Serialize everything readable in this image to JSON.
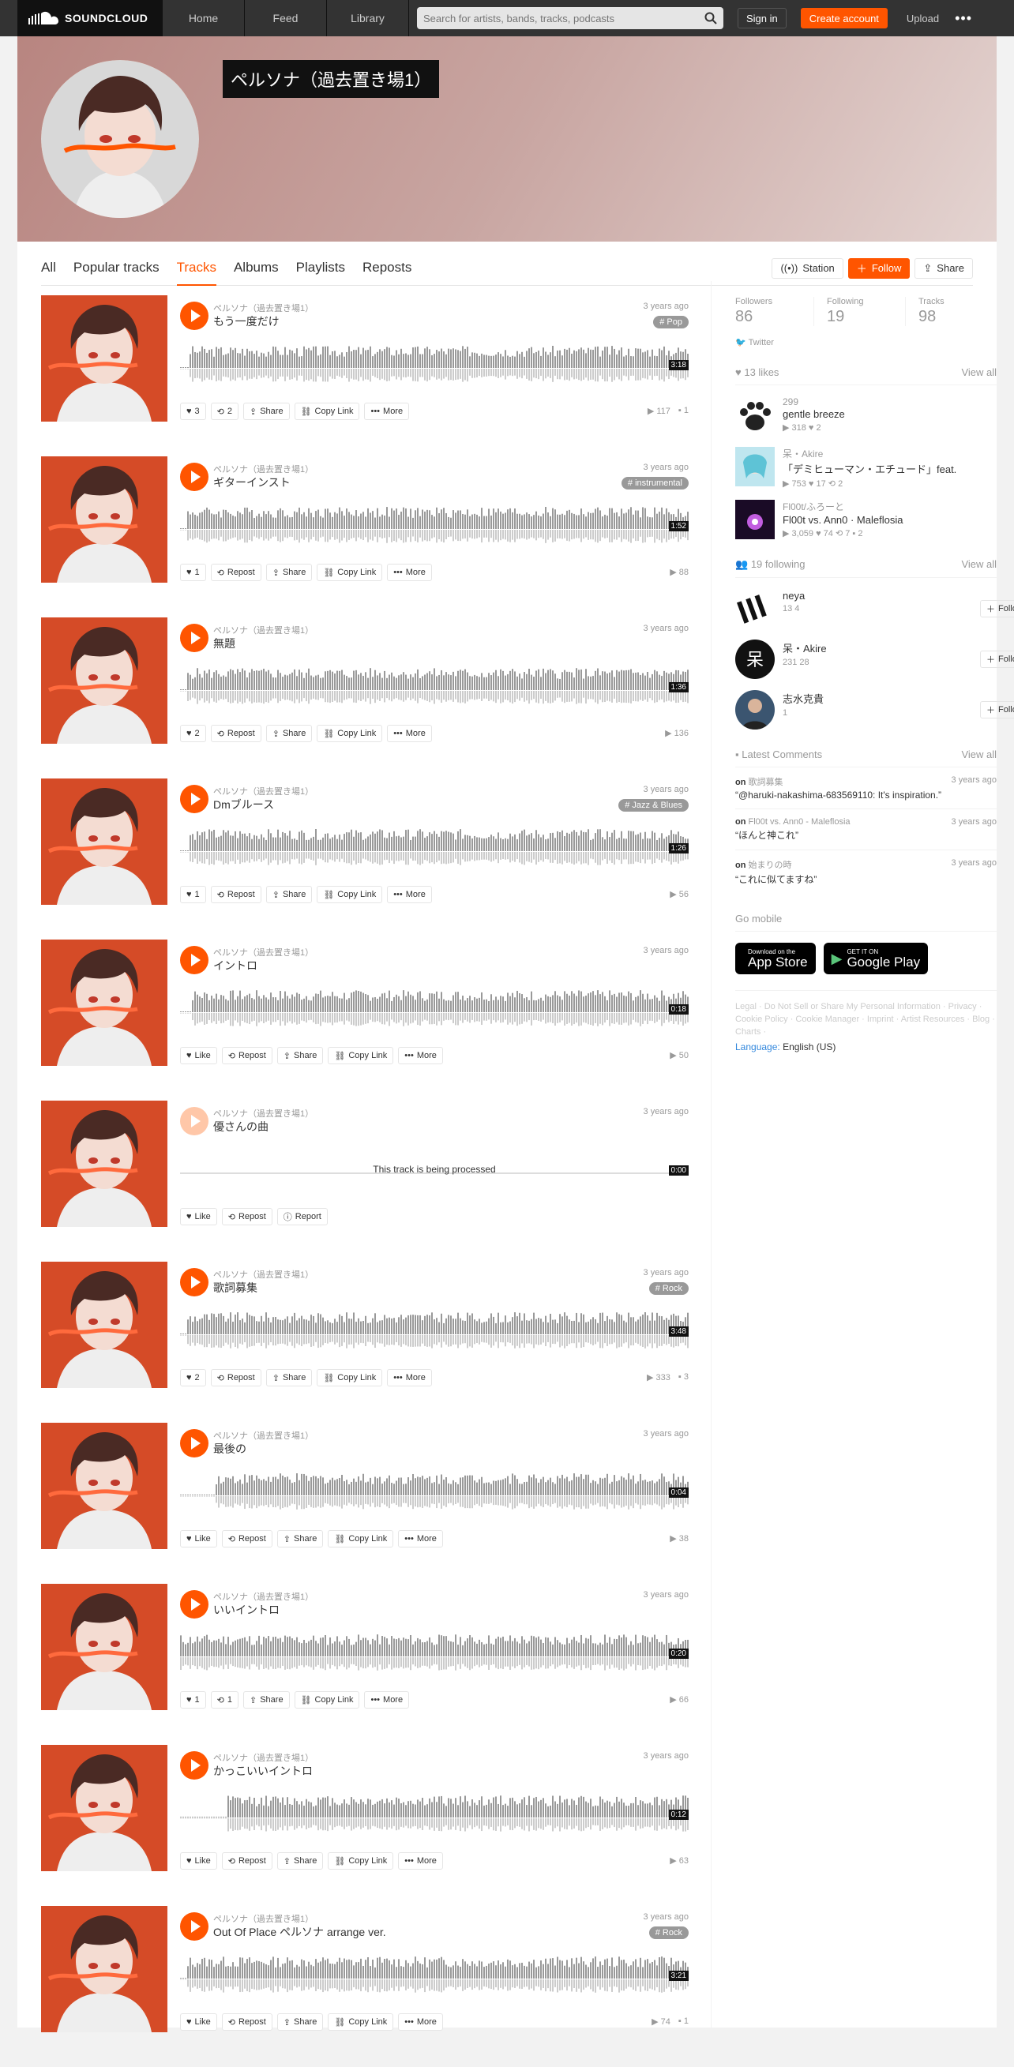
{
  "header": {
    "logo": "SOUNDCLOUD",
    "nav": [
      "Home",
      "Feed",
      "Library"
    ],
    "search_placeholder": "Search for artists, bands, tracks, podcasts",
    "sign_in": "Sign in",
    "create_account": "Create account",
    "upload": "Upload",
    "more": "•••"
  },
  "profile": {
    "name": "ペルソナ（過去置き場1）"
  },
  "tabs": [
    "All",
    "Popular tracks",
    "Tracks",
    "Albums",
    "Playlists",
    "Reposts"
  ],
  "tab_actions": {
    "station": "Station",
    "follow": "Follow",
    "share": "Share"
  },
  "tracks": [
    {
      "uploader": "ペルソナ（過去置き場1）",
      "title": "もう一度だけ",
      "ago": "3 years ago",
      "genre": "# Pop",
      "duration": "3:18",
      "likes": "3",
      "reposts": "2",
      "plays": "117",
      "comments": "1",
      "share": "Share",
      "copy": "Copy Link",
      "more": "More"
    },
    {
      "uploader": "ペルソナ（過去置き場1）",
      "title": "ギターインスト",
      "ago": "3 years ago",
      "genre": "# instrumental",
      "duration": "1:52",
      "likes": "1",
      "reposts": "Repost",
      "plays": "88",
      "comments": "",
      "share": "Share",
      "copy": "Copy Link",
      "more": "More"
    },
    {
      "uploader": "ペルソナ（過去置き場1）",
      "title": "無題",
      "ago": "3 years ago",
      "genre": "",
      "duration": "1:36",
      "likes": "2",
      "reposts": "Repost",
      "plays": "136",
      "comments": "",
      "share": "Share",
      "copy": "Copy Link",
      "more": "More"
    },
    {
      "uploader": "ペルソナ（過去置き場1）",
      "title": "Dmブルース",
      "ago": "3 years ago",
      "genre": "# Jazz & Blues",
      "duration": "1:26",
      "likes": "1",
      "reposts": "Repost",
      "plays": "56",
      "comments": "",
      "share": "Share",
      "copy": "Copy Link",
      "more": "More"
    },
    {
      "uploader": "ペルソナ（過去置き場1）",
      "title": "イントロ",
      "ago": "3 years ago",
      "genre": "",
      "duration": "0:18",
      "likes": "Like",
      "reposts": "Repost",
      "plays": "50",
      "comments": "",
      "share": "Share",
      "copy": "Copy Link",
      "more": "More"
    },
    {
      "uploader": "ペルソナ（過去置き場1）",
      "title": "優さんの曲",
      "ago": "3 years ago",
      "genre": "",
      "duration": "0:00",
      "likes": "Like",
      "reposts": "Repost",
      "plays": "",
      "comments": "",
      "processing": "This track is being processed",
      "report": "Report"
    },
    {
      "uploader": "ペルソナ（過去置き場1）",
      "title": "歌詞募集",
      "ago": "3 years ago",
      "genre": "# Rock",
      "duration": "3:48",
      "likes": "2",
      "reposts": "Repost",
      "plays": "333",
      "comments": "3",
      "share": "Share",
      "copy": "Copy Link",
      "more": "More"
    },
    {
      "uploader": "ペルソナ（過去置き場1）",
      "title": "最後の",
      "ago": "3 years ago",
      "genre": "",
      "duration": "0:04",
      "likes": "Like",
      "reposts": "Repost",
      "plays": "38",
      "comments": "",
      "share": "Share",
      "copy": "Copy Link",
      "more": "More"
    },
    {
      "uploader": "ペルソナ（過去置き場1）",
      "title": "いいイントロ",
      "ago": "3 years ago",
      "genre": "",
      "duration": "0:20",
      "likes": "1",
      "reposts": "1",
      "plays": "66",
      "comments": "",
      "share": "Share",
      "copy": "Copy Link",
      "more": "More"
    },
    {
      "uploader": "ペルソナ（過去置き場1）",
      "title": "かっこいいイントロ",
      "ago": "3 years ago",
      "genre": "",
      "duration": "0:12",
      "likes": "Like",
      "reposts": "Repost",
      "plays": "63",
      "comments": "",
      "share": "Share",
      "copy": "Copy Link",
      "more": "More"
    },
    {
      "uploader": "ペルソナ（過去置き場1）",
      "title": "Out Of Place ペルソナ arrange ver.",
      "ago": "3 years ago",
      "genre": "# Rock",
      "duration": "3:21",
      "likes": "Like",
      "reposts": "Repost",
      "plays": "74",
      "comments": "1",
      "share": "Share",
      "copy": "Copy Link",
      "more": "More"
    }
  ],
  "sidebar": {
    "counts": [
      {
        "label": "Followers",
        "value": "86"
      },
      {
        "label": "Following",
        "value": "19"
      },
      {
        "label": "Tracks",
        "value": "98"
      }
    ],
    "twitter": "Twitter",
    "likes_header": "13 likes",
    "view_all": "View all",
    "likes": [
      {
        "name": "299",
        "title": "gentle breeze",
        "meta": "▶ 318   ♥ 2"
      },
      {
        "name": "呆・Akire",
        "title": "「デミヒューマン・エチュード」feat.",
        "meta": "▶ 753   ♥ 17   ⟲ 2"
      },
      {
        "name": "Fl00t/ふろーと",
        "title": "Fl00t vs. Ann0 · Maleflosia",
        "meta": "▶ 3,059   ♥ 74   ⟲ 7   ▪ 2"
      }
    ],
    "following_header": "19 following",
    "following": [
      {
        "name": "neya",
        "meta": "13   4",
        "follow": "Follow"
      },
      {
        "name": "呆・Akire",
        "meta": "231   28",
        "follow": "Follow"
      },
      {
        "name": "志水克貴",
        "meta": "1",
        "follow": "Follow"
      }
    ],
    "comments_header": "Latest Comments",
    "comments": [
      {
        "on": "on",
        "track": "歌詞募集",
        "ago": "3 years ago",
        "text": "“@haruki-nakashima-683569110: It's inspiration.”"
      },
      {
        "on": "on",
        "track": "Fl00t vs. Ann0 - Maleflosia",
        "ago": "3 years ago",
        "text": "“ほんと神これ”"
      },
      {
        "on": "on",
        "track": "始まりの時",
        "ago": "3 years ago",
        "text": "“これに似てますね”"
      }
    ],
    "go_mobile": "Go mobile",
    "appstore_small": "Download on the",
    "appstore_big": "App Store",
    "googleplay_small": "GET IT ON",
    "googleplay_big": "Google Play",
    "legal": "Legal · Do Not Sell or Share My Personal Information · Privacy · Cookie Policy · Cookie Manager · Imprint · Artist Resources · Blog · Charts ·",
    "language_label": "Language:",
    "language_value": "English (US)"
  },
  "colors": {
    "accent": "#ff5500",
    "dark": "#333333",
    "art": "#d54b27"
  }
}
